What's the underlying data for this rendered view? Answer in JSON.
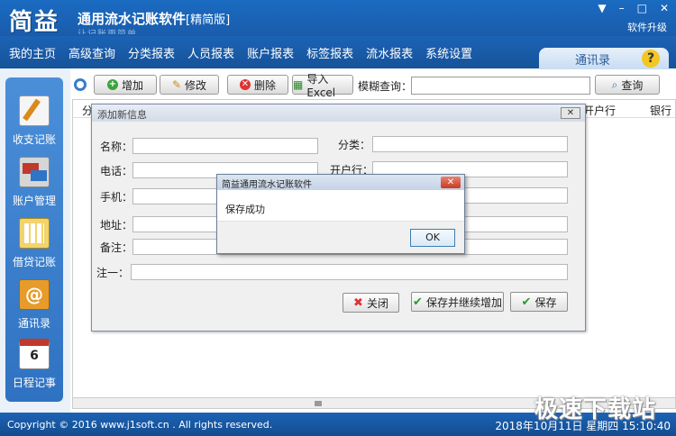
{
  "app": {
    "logo": "简益",
    "title": "通用流水记账软件",
    "edition": "[精简版]",
    "slogan": "让记账更简单",
    "window_controls": {
      "menu": "▼",
      "minimize": "–",
      "maximize": "□",
      "close": "✕"
    },
    "upgrade": "软件升级"
  },
  "menu": [
    "我的主页",
    "高级查询",
    "分类报表",
    "人员报表",
    "账户报表",
    "标签报表",
    "流水报表",
    "系统设置"
  ],
  "address_tab": {
    "label": "通讯录",
    "help": "?"
  },
  "sidebar": {
    "items": [
      {
        "label": "收支记账",
        "icon": "edit-pen-icon"
      },
      {
        "label": "账户管理",
        "icon": "bank-card-icon"
      },
      {
        "label": "借贷记账",
        "icon": "calculator-icon"
      },
      {
        "label": "通讯录",
        "icon": "address-book-icon"
      },
      {
        "label": "日程记事",
        "icon": "calendar-icon",
        "badge": "6"
      }
    ]
  },
  "toolbar": {
    "add": "增加",
    "edit": "修改",
    "delete": "删除",
    "import": "导入Excel",
    "fuzzy_label": "模糊查询：",
    "search_value": "",
    "query": "查询"
  },
  "grid": {
    "headers": [
      "分",
      "开户行",
      "银行"
    ]
  },
  "dialog": {
    "title": "添加新信息",
    "close": "✕",
    "fields": {
      "name": "名称：",
      "category": "分类：",
      "phone": "电话：",
      "bank": "开户行：",
      "mobile": "手机：",
      "address": "地址：",
      "remark": "备注：",
      "note1": "注一："
    },
    "buttons": {
      "close": "关闭",
      "save_continue": "保存并继续增加",
      "save": "保存"
    }
  },
  "message_box": {
    "title": "简益通用流水记账软件",
    "text": "保存成功",
    "ok": "OK"
  },
  "status": {
    "copyright": "Copyright © 2016 www.j1soft.cn . All rights reserved.",
    "datetime": "2018年10月11日  星期四 15:10:40"
  },
  "watermark": "极速下载站"
}
